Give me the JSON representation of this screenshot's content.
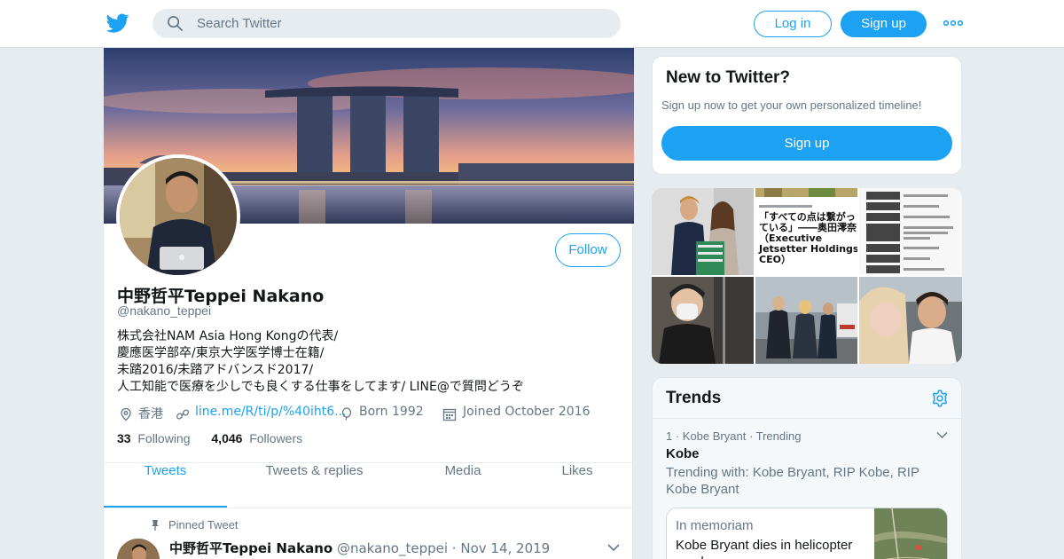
{
  "topbar": {
    "logo_icon": "twitter-bird-icon",
    "search_placeholder": "Search Twitter",
    "login_label": "Log in",
    "signup_label": "Sign up",
    "more_icon": "more-dots-icon",
    "accent_color": "#1da1f2"
  },
  "profile": {
    "display_name": "中野哲平Teppei Nakano",
    "handle": "@nakano_teppei",
    "follow_label": "Follow",
    "bio": [
      "株式会社NAM Asia Hong Kongの代表/",
      "慶應医学部卒/東京大学医学博士在籍/",
      "未踏2016/未踏アドバンスド2017/",
      "人工知能で医療を少しでも良くする仕事をしてます/ LINE@で質問どうぞ"
    ],
    "location": "香港",
    "url": "line.me/R/ti/p/%40iht6...",
    "born": "Born 1992",
    "joined": "Joined October 2016",
    "following_count": "33",
    "following_label": "Following",
    "followers_count": "4,046",
    "followers_label": "Followers"
  },
  "tabs": [
    {
      "label": "Tweets",
      "active": true
    },
    {
      "label": "Tweets & replies",
      "active": false
    },
    {
      "label": "Media",
      "active": false
    },
    {
      "label": "Likes",
      "active": false
    }
  ],
  "pinned_tweet": {
    "label": "Pinned Tweet",
    "name": "中野哲平Teppei Nakano",
    "handle": "@nakano_teppei",
    "sep": "·",
    "date": "Nov 14, 2019"
  },
  "signup_box": {
    "title": "New to Twitter?",
    "subtitle": "Sign up now to get your own personalized timeline!",
    "button": "Sign up"
  },
  "media_grid": {
    "article_headline": "「すべての点は繋がっている」――奥田澪奈（Executive Jetsetter Holdings CEO）",
    "article_lines": [
      "「すべての点は繋がっ",
      "ている」――奥田澪奈",
      "（Executive",
      "Jetsetter Holdings",
      "CEO）"
    ]
  },
  "trends": {
    "title": "Trends",
    "items": [
      {
        "context": "1 · Kobe Bryant · Trending",
        "name": "Kobe",
        "with": "Trending with: Kobe Bryant, RIP Kobe, RIP Kobe Bryant",
        "card_kicker": "In memoriam",
        "card_title": "Kobe Bryant dies in helicopter crash"
      }
    ]
  }
}
